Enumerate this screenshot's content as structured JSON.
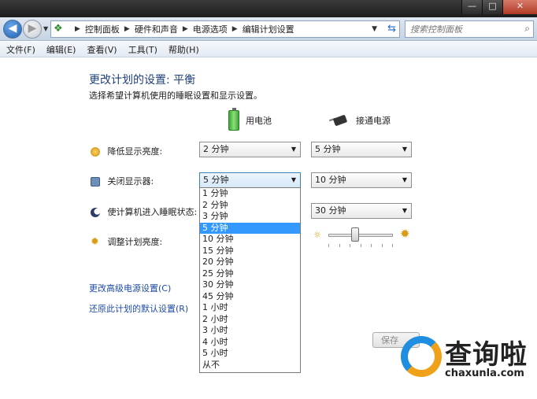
{
  "window": {
    "minimize": "—",
    "maximize": "□",
    "close": "✕"
  },
  "address": {
    "crumbs": [
      "控制面板",
      "硬件和声音",
      "电源选项",
      "编辑计划设置"
    ],
    "search_placeholder": "搜索控制面板"
  },
  "menu": [
    "文件(F)",
    "编辑(E)",
    "查看(V)",
    "工具(T)",
    "帮助(H)"
  ],
  "page": {
    "title": "更改计划的设置: 平衡",
    "subtitle": "选择希望计算机使用的睡眠设置和显示设置。"
  },
  "columns": {
    "battery": "用电池",
    "plugged": "接通电源"
  },
  "rows": [
    {
      "label": "降低显示亮度:",
      "battery": "2 分钟",
      "plugged": "5 分钟"
    },
    {
      "label": "关闭显示器:",
      "battery": "5 分钟",
      "plugged": "10 分钟"
    },
    {
      "label": "使计算机进入睡眠状态:",
      "battery": "",
      "plugged": "30 分钟"
    },
    {
      "label": "调整计划亮度:"
    }
  ],
  "brightness_level": 0.4,
  "dropdown_options": [
    "1 分钟",
    "2 分钟",
    "3 分钟",
    "5 分钟",
    "10 分钟",
    "15 分钟",
    "20 分钟",
    "25 分钟",
    "30 分钟",
    "45 分钟",
    "1 小时",
    "2 小时",
    "3 小时",
    "4 小时",
    "5 小时",
    "从不"
  ],
  "dropdown_selected": "5 分钟",
  "links": {
    "advanced": "更改高级电源设置(C)",
    "restore": "还原此计划的默认设置(R)"
  },
  "buttons": {
    "save": "保存"
  },
  "watermark": {
    "text": "查询啦",
    "url": "chaxunla.com"
  }
}
